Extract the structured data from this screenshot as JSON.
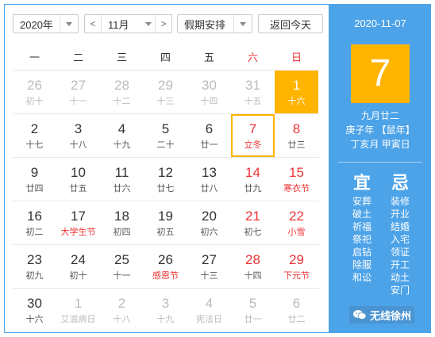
{
  "toolbar": {
    "year": "2020年",
    "month": "11月",
    "holiday": "假期安排",
    "today": "返回今天",
    "prev": "<",
    "next": ">"
  },
  "weekdays": [
    "一",
    "二",
    "三",
    "四",
    "五",
    "六",
    "日"
  ],
  "weeks": [
    [
      {
        "d": "26",
        "l": "初十",
        "other": true
      },
      {
        "d": "27",
        "l": "十一",
        "other": true
      },
      {
        "d": "28",
        "l": "十二",
        "other": true
      },
      {
        "d": "29",
        "l": "十三",
        "other": true
      },
      {
        "d": "30",
        "l": "十四",
        "other": true
      },
      {
        "d": "31",
        "l": "十五",
        "other": true
      },
      {
        "d": "1",
        "l": "十六",
        "sel": true
      }
    ],
    [
      {
        "d": "2",
        "l": "十七"
      },
      {
        "d": "3",
        "l": "十八"
      },
      {
        "d": "4",
        "l": "十九"
      },
      {
        "d": "5",
        "l": "二十"
      },
      {
        "d": "6",
        "l": "廿一"
      },
      {
        "d": "7",
        "l": "立冬",
        "today": true
      },
      {
        "d": "8",
        "l": "廿三"
      }
    ],
    [
      {
        "d": "9",
        "l": "廿四"
      },
      {
        "d": "10",
        "l": "廿五"
      },
      {
        "d": "11",
        "l": "廿六"
      },
      {
        "d": "12",
        "l": "廿七"
      },
      {
        "d": "13",
        "l": "廿八"
      },
      {
        "d": "14",
        "l": "廿九"
      },
      {
        "d": "15",
        "l": "寒衣节",
        "red": true
      }
    ],
    [
      {
        "d": "16",
        "l": "初二"
      },
      {
        "d": "17",
        "l": "大学生节",
        "red": true
      },
      {
        "d": "18",
        "l": "初四"
      },
      {
        "d": "19",
        "l": "初五"
      },
      {
        "d": "20",
        "l": "初六"
      },
      {
        "d": "21",
        "l": "初七"
      },
      {
        "d": "22",
        "l": "小雪",
        "red": true
      }
    ],
    [
      {
        "d": "23",
        "l": "初九"
      },
      {
        "d": "24",
        "l": "初十"
      },
      {
        "d": "25",
        "l": "十一"
      },
      {
        "d": "26",
        "l": "感恩节",
        "red": true
      },
      {
        "d": "27",
        "l": "十三"
      },
      {
        "d": "28",
        "l": "十四"
      },
      {
        "d": "29",
        "l": "下元节",
        "red": true
      }
    ],
    [
      {
        "d": "30",
        "l": "十六"
      },
      {
        "d": "1",
        "l": "艾滋病日",
        "other": true
      },
      {
        "d": "2",
        "l": "十八",
        "other": true
      },
      {
        "d": "3",
        "l": "十九",
        "other": true
      },
      {
        "d": "4",
        "l": "宪法日",
        "other": true
      },
      {
        "d": "5",
        "l": "廿一",
        "other": true
      },
      {
        "d": "6",
        "l": "廿二",
        "other": true
      }
    ]
  ],
  "side": {
    "date": "2020-11-07",
    "day": "7",
    "lunar": "九月廿二",
    "ganzhi_year": "庚子年 【鼠年】",
    "ganzhi_day": "丁亥月 甲寅日",
    "yi_title": "宜",
    "ji_title": "忌",
    "yi": [
      "安葬",
      "破土",
      "祈福",
      "祭祀",
      "启钻",
      "除服",
      "和讼"
    ],
    "ji": [
      "装修",
      "开业",
      "结婚",
      "入宅",
      "领证",
      "开工",
      "动土",
      "安门"
    ]
  },
  "watermark": "无线徐州",
  "colors": {
    "accent": "#4da3e8",
    "highlight": "#ffb400",
    "red": "#e33333"
  }
}
